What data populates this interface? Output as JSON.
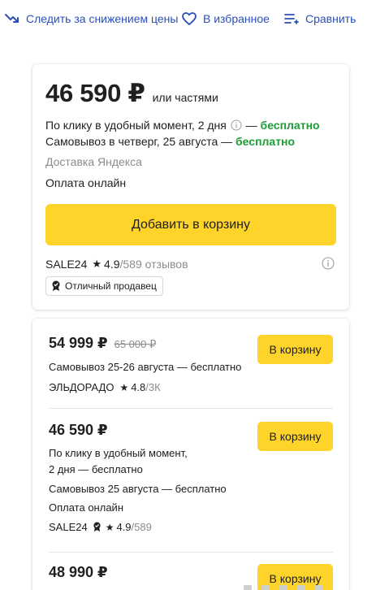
{
  "top_actions": {
    "price_watch": "Следить за снижением цены",
    "favorites": "В избранное",
    "compare": "Сравнить"
  },
  "main_offer": {
    "price": "46 590 ₽",
    "installments": "или частями",
    "delivery_click": "По клику в удобный момент, 2 дня",
    "delivery_click_dash": "—",
    "delivery_click_cost": "бесплатно",
    "pickup": "Самовывоз в четверг, 25 августа —",
    "pickup_cost": "бесплатно",
    "delivery_service": "Доставка Яндекса",
    "payment": "Оплата онлайн",
    "add_to_cart": "Добавить в корзину",
    "seller": "SALE24",
    "rating": "4.9",
    "reviews": "/589 отзывов",
    "seller_badge": "Отличный продавец"
  },
  "offers": [
    {
      "price": "54 999 ₽",
      "old_price": "65 000 ₽",
      "lines": [
        "Самовывоз 25-26 августа — бесплатно"
      ],
      "seller": "ЭЛЬДОРАДО",
      "rating": "4.8",
      "reviews": "/3К",
      "button": "В корзину"
    },
    {
      "price": "46 590 ₽",
      "lines": [
        "По клику в удобный момент,",
        "2 дня — бесплатно",
        "Самовывоз 25 августа — бесплатно",
        "Оплата онлайн"
      ],
      "seller": "SALE24",
      "rating": "4.9",
      "reviews": "/589",
      "button": "В корзину"
    },
    {
      "price": "48 990 ₽",
      "button": "В корзину"
    }
  ],
  "colors": {
    "link": "#2a4fba",
    "accent_button": "#fed42b",
    "free_green": "#1b9e34",
    "muted": "#8c8c8c"
  }
}
